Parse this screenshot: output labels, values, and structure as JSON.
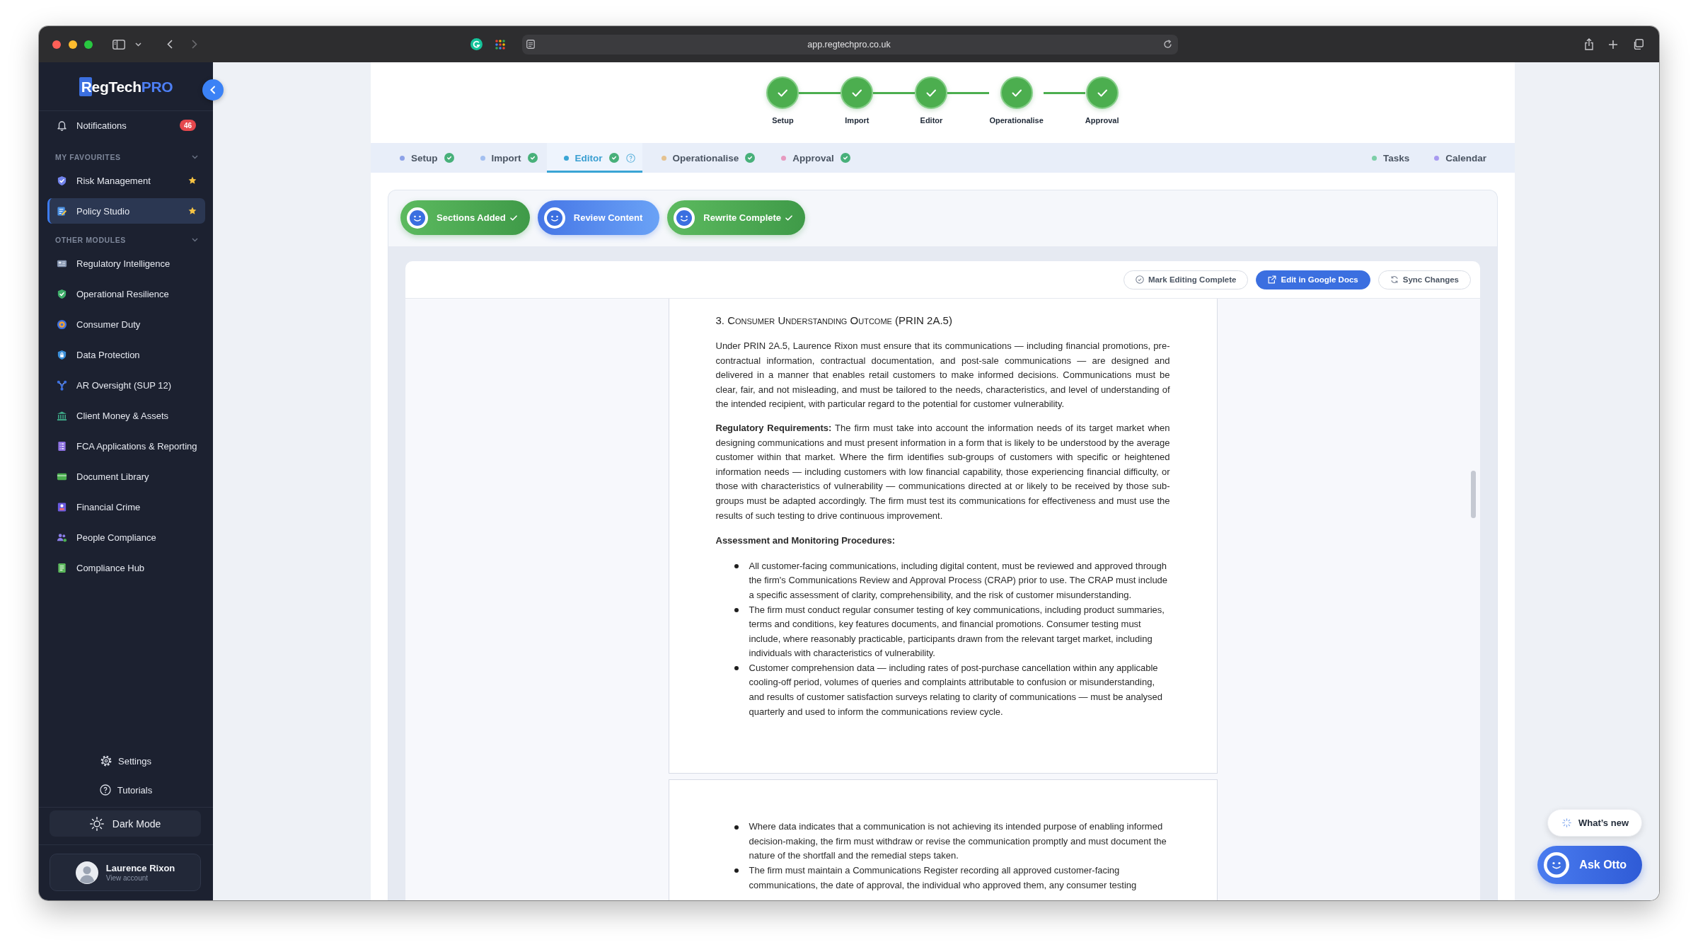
{
  "browser": {
    "url": "app.regtechpro.co.uk"
  },
  "sidebar": {
    "logo": {
      "mark": "R",
      "name": "egTech",
      "accent": "PRO"
    },
    "notifications": {
      "label": "Notifications",
      "count": "46"
    },
    "sections": [
      {
        "title": "MY FAVOURITES",
        "expanded": true,
        "items": [
          {
            "label": "Risk Management",
            "selected": false,
            "starred": true
          },
          {
            "label": "Policy Studio",
            "selected": true,
            "starred": true
          }
        ]
      },
      {
        "title": "OTHER MODULES",
        "expanded": true,
        "items": [
          {
            "label": "Regulatory Intelligence",
            "selected": false,
            "starred": false
          },
          {
            "label": "Operational Resilience",
            "selected": false,
            "starred": false
          },
          {
            "label": "Consumer Duty",
            "selected": false,
            "starred": false
          },
          {
            "label": "Data Protection",
            "selected": false,
            "starred": false
          },
          {
            "label": "AR Oversight (SUP 12)",
            "selected": false,
            "starred": false
          },
          {
            "label": "Client Money & Assets",
            "selected": false,
            "starred": false
          },
          {
            "label": "FCA Applications & Reporting",
            "selected": false,
            "starred": false
          },
          {
            "label": "Document Library",
            "selected": false,
            "starred": false
          },
          {
            "label": "Financial Crime",
            "selected": false,
            "starred": false
          },
          {
            "label": "People Compliance",
            "selected": false,
            "starred": false
          },
          {
            "label": "Compliance Hub",
            "selected": false,
            "starred": false
          }
        ]
      }
    ],
    "footer_links": [
      {
        "label": "Settings"
      },
      {
        "label": "Tutorials"
      }
    ],
    "dark_mode": {
      "label": "Dark Mode"
    },
    "account": {
      "name": "Laurence Rixon",
      "subtitle": "View account"
    }
  },
  "stepper": [
    {
      "label": "Setup",
      "done": true
    },
    {
      "label": "Import",
      "done": true
    },
    {
      "label": "Editor",
      "done": true
    },
    {
      "label": "Operationalise",
      "done": true
    },
    {
      "label": "Approval",
      "done": true
    }
  ],
  "tabs": [
    {
      "label": "Setup",
      "color": "#8da2e8",
      "done": true,
      "help": false,
      "selected": false
    },
    {
      "label": "Import",
      "color": "#a3bff0",
      "done": true,
      "help": false,
      "selected": false
    },
    {
      "label": "Editor",
      "color": "#3aa5d5",
      "done": true,
      "help": true,
      "selected": true
    },
    {
      "label": "Operationalise",
      "color": "#e5c290",
      "done": true,
      "help": false,
      "selected": false
    },
    {
      "label": "Approval",
      "color": "#e79ac0",
      "done": true,
      "help": false,
      "selected": false
    }
  ],
  "views": [
    {
      "label": "Tasks",
      "color": "#7dcfa8",
      "selected": false
    },
    {
      "label": "Calendar",
      "color": "#a89af0",
      "selected": false
    }
  ],
  "progress": [
    {
      "label": "Sections Added",
      "done": true
    },
    {
      "label": "Review Content",
      "done": false
    },
    {
      "label": "Rewrite Complete",
      "done": true
    }
  ],
  "doc_actions": [
    {
      "label": "Mark Editing Complete",
      "kind": "outline"
    },
    {
      "label": "Edit in Google Docs",
      "kind": "primary"
    },
    {
      "label": "Sync Changes",
      "kind": "outline"
    }
  ],
  "document": {
    "pages": [
      {
        "blocks": [
          {
            "kind": "heading",
            "text": "3. Consumer Understanding Outcome (PRIN 2A.5)"
          },
          {
            "kind": "paragraph",
            "text": "Under PRIN 2A.5, Laurence Rixon must ensure that its communications — including financial promotions, pre-contractual information, contractual documentation, and post-sale communications — are designed and delivered in a manner that enables retail customers to make informed decisions. Communications must be clear, fair, and not misleading, and must be tailored to the needs, characteristics, and level of understanding of the intended recipient, with particular regard to the potential for customer vulnerability."
          },
          {
            "kind": "paragraph",
            "text": "**Regulatory Requirements:** The firm must take into account the information needs of its target market when designing communications and must present information in a form that is likely to be understood by the average customer within that market. Where the firm identifies sub-groups of customers with specific or heightened information needs — including customers with low financial capability, those experiencing financial difficulty, or those with characteristics of vulnerability — communications directed at or likely to be received by those sub-groups must be adapted accordingly. The firm must test its communications for effectiveness and must use the results of such testing to drive continuous improvement."
          },
          {
            "kind": "subheading",
            "text": "Assessment and Monitoring Procedures:"
          },
          {
            "kind": "bullet",
            "text": "All customer-facing communications, including digital content, must be reviewed and approved through the firm's Communications Review and Approval Process (CRAP) prior to use. The CRAP must include a specific assessment of clarity, comprehensibility, and the risk of customer misunderstanding."
          },
          {
            "kind": "bullet",
            "text": "The firm must conduct regular consumer testing of key communications, including product summaries, terms and conditions, key features documents, and financial promotions. Consumer testing must include, where reasonably practicable, participants drawn from the relevant target market, including individuals with characteristics of vulnerability."
          },
          {
            "kind": "bullet",
            "text": "Customer comprehension data — including rates of post-purchase cancellation within any applicable cooling-off period, volumes of queries and complaints attributable to confusion or misunderstanding, and results of customer satisfaction surveys relating to clarity of communications — must be analysed quarterly and used to inform the communications review cycle."
          }
        ]
      },
      {
        "blocks": [
          {
            "kind": "bullet",
            "text": "Where data indicates that a communication is not achieving its intended purpose of enabling informed decision-making, the firm must withdraw or revise the communication promptly and must document the nature of the shortfall and the remedial steps taken."
          },
          {
            "kind": "bullet",
            "text": "The firm must maintain a Communications Register recording all approved customer-facing communications, the date of approval, the individual who approved them, any consumer testing"
          }
        ]
      }
    ]
  },
  "whats_new": {
    "label": "What’s new"
  },
  "assistant": {
    "label": "Ask Otto"
  }
}
